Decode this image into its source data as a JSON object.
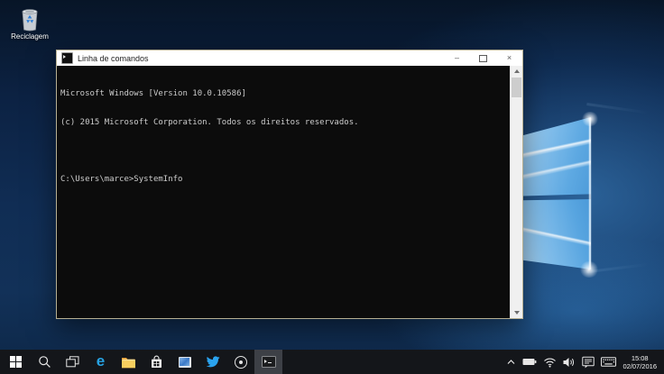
{
  "desktop": {
    "recycle_bin_label": "Reciclagem"
  },
  "console_window": {
    "title": "Linha de comandos",
    "controls": {
      "minimize_glyph": "–",
      "close_glyph": "×"
    },
    "lines": [
      "Microsoft Windows [Version 10.0.10586]",
      "(c) 2015 Microsoft Corporation. Todos os direitos reservados.",
      "",
      "C:\\Users\\marce>SystemInfo"
    ]
  },
  "taskbar": {
    "edge_letter": "e",
    "icons": [
      "start",
      "search",
      "task-view",
      "edge",
      "file-explorer",
      "store",
      "pinned-app",
      "twitter",
      "recorder",
      "command-prompt"
    ],
    "active_app": "command-prompt",
    "tray_icons": [
      "chevron-up",
      "battery",
      "wifi",
      "volume",
      "action-center",
      "touch-keyboard"
    ],
    "clock": {
      "time": "15:08",
      "date": "02/07/2016"
    }
  },
  "colors": {
    "taskbar_bg": "#14161a",
    "active_app_bg": "#3d4046",
    "console_bg": "#0c0c0c",
    "console_text": "#cccccc",
    "titlebar_bg": "#ffffff",
    "window_border": "#b7b093",
    "edge_blue": "#27a3e4",
    "twitter_blue": "#2aa3ef",
    "folder_yellow": "#f7cf5f",
    "hero_pane_blue": "#6cb4e8",
    "wallpaper_dark": "#0c2243"
  }
}
